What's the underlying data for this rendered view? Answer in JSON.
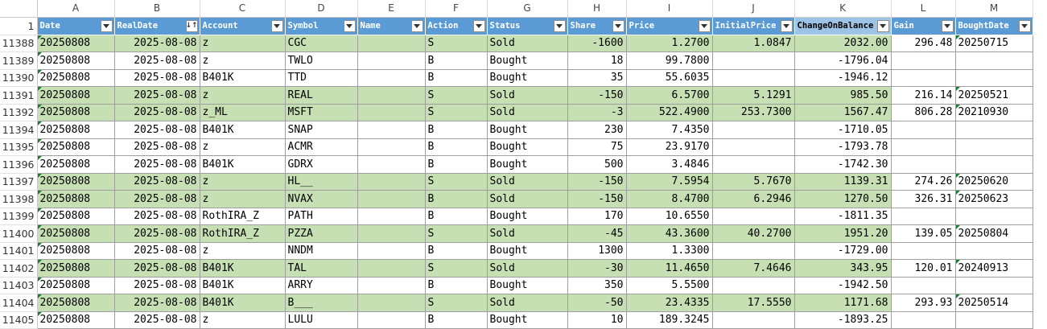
{
  "colLetters": [
    "A",
    "B",
    "C",
    "D",
    "E",
    "F",
    "G",
    "H",
    "I",
    "J",
    "K",
    "L",
    "M"
  ],
  "headerRowNumber": "1",
  "fields": [
    "Date",
    "RealDate",
    "Account",
    "Symbol",
    "Name",
    "Action",
    "Status",
    "Share",
    "Price",
    "InitialPrice",
    "ChangeOnBalance",
    "Gain",
    "BoughtDate"
  ],
  "activeFilterColumn": "RealDate",
  "selectedHeader": "ChangeOnBalance",
  "rows": [
    {
      "r": "11388",
      "Date": "20250808",
      "RealDate": "2025-08-08",
      "Account": "z",
      "Symbol": "CGC",
      "Name": "",
      "Action": "S",
      "Status": "Sold",
      "Share": "-1600",
      "Price": "1.2700",
      "InitialPrice": "1.0847",
      "ChangeOnBalance": "2032.00",
      "Gain": "296.48",
      "BoughtDate": "20250715"
    },
    {
      "r": "11389",
      "Date": "20250808",
      "RealDate": "2025-08-08",
      "Account": "z",
      "Symbol": "TWLO",
      "Name": "",
      "Action": "B",
      "Status": "Bought",
      "Share": "18",
      "Price": "99.7800",
      "InitialPrice": "",
      "ChangeOnBalance": "-1796.04",
      "Gain": "",
      "BoughtDate": ""
    },
    {
      "r": "11390",
      "Date": "20250808",
      "RealDate": "2025-08-08",
      "Account": "B401K",
      "Symbol": "TTD",
      "Name": "",
      "Action": "B",
      "Status": "Bought",
      "Share": "35",
      "Price": "55.6035",
      "InitialPrice": "",
      "ChangeOnBalance": "-1946.12",
      "Gain": "",
      "BoughtDate": ""
    },
    {
      "r": "11391",
      "Date": "20250808",
      "RealDate": "2025-08-08",
      "Account": "z",
      "Symbol": "REAL",
      "Name": "",
      "Action": "S",
      "Status": "Sold",
      "Share": "-150",
      "Price": "6.5700",
      "InitialPrice": "5.1291",
      "ChangeOnBalance": "985.50",
      "Gain": "216.14",
      "BoughtDate": "20250521"
    },
    {
      "r": "11392",
      "Date": "20250808",
      "RealDate": "2025-08-08",
      "Account": "z_ML",
      "Symbol": "MSFT",
      "Name": "",
      "Action": "S",
      "Status": "Sold",
      "Share": "-3",
      "Price": "522.4900",
      "InitialPrice": "253.7300",
      "ChangeOnBalance": "1567.47",
      "Gain": "806.28",
      "BoughtDate": "20210930"
    },
    {
      "r": "11394",
      "Date": "20250808",
      "RealDate": "2025-08-08",
      "Account": "B401K",
      "Symbol": "SNAP",
      "Name": "",
      "Action": "B",
      "Status": "Bought",
      "Share": "230",
      "Price": "7.4350",
      "InitialPrice": "",
      "ChangeOnBalance": "-1710.05",
      "Gain": "",
      "BoughtDate": ""
    },
    {
      "r": "11395",
      "Date": "20250808",
      "RealDate": "2025-08-08",
      "Account": "z",
      "Symbol": "ACMR",
      "Name": "",
      "Action": "B",
      "Status": "Bought",
      "Share": "75",
      "Price": "23.9170",
      "InitialPrice": "",
      "ChangeOnBalance": "-1793.78",
      "Gain": "",
      "BoughtDate": ""
    },
    {
      "r": "11396",
      "Date": "20250808",
      "RealDate": "2025-08-08",
      "Account": "B401K",
      "Symbol": "GDRX",
      "Name": "",
      "Action": "B",
      "Status": "Bought",
      "Share": "500",
      "Price": "3.4846",
      "InitialPrice": "",
      "ChangeOnBalance": "-1742.30",
      "Gain": "",
      "BoughtDate": ""
    },
    {
      "r": "11397",
      "Date": "20250808",
      "RealDate": "2025-08-08",
      "Account": "z",
      "Symbol": "HL__",
      "Name": "",
      "Action": "S",
      "Status": "Sold",
      "Share": "-150",
      "Price": "7.5954",
      "InitialPrice": "5.7670",
      "ChangeOnBalance": "1139.31",
      "Gain": "274.26",
      "BoughtDate": "20250620"
    },
    {
      "r": "11398",
      "Date": "20250808",
      "RealDate": "2025-08-08",
      "Account": "z",
      "Symbol": "NVAX",
      "Name": "",
      "Action": "B",
      "Status": "Sold",
      "Share": "-150",
      "Price": "8.4700",
      "InitialPrice": "6.2946",
      "ChangeOnBalance": "1270.50",
      "Gain": "326.31",
      "BoughtDate": "20250623"
    },
    {
      "r": "11399",
      "Date": "20250808",
      "RealDate": "2025-08-08",
      "Account": "RothIRA_Z",
      "Symbol": "PATH",
      "Name": "",
      "Action": "B",
      "Status": "Bought",
      "Share": "170",
      "Price": "10.6550",
      "InitialPrice": "",
      "ChangeOnBalance": "-1811.35",
      "Gain": "",
      "BoughtDate": ""
    },
    {
      "r": "11400",
      "Date": "20250808",
      "RealDate": "2025-08-08",
      "Account": "RothIRA_Z",
      "Symbol": "PZZA",
      "Name": "",
      "Action": "S",
      "Status": "Sold",
      "Share": "-45",
      "Price": "43.3600",
      "InitialPrice": "40.2700",
      "ChangeOnBalance": "1951.20",
      "Gain": "139.05",
      "BoughtDate": "20250804"
    },
    {
      "r": "11401",
      "Date": "20250808",
      "RealDate": "2025-08-08",
      "Account": "z",
      "Symbol": "NNDM",
      "Name": "",
      "Action": "B",
      "Status": "Bought",
      "Share": "1300",
      "Price": "1.3300",
      "InitialPrice": "",
      "ChangeOnBalance": "-1729.00",
      "Gain": "",
      "BoughtDate": ""
    },
    {
      "r": "11402",
      "Date": "20250808",
      "RealDate": "2025-08-08",
      "Account": "B401K",
      "Symbol": "TAL",
      "Name": "",
      "Action": "S",
      "Status": "Sold",
      "Share": "-30",
      "Price": "11.4650",
      "InitialPrice": "7.4646",
      "ChangeOnBalance": "343.95",
      "Gain": "120.01",
      "BoughtDate": "20240913"
    },
    {
      "r": "11403",
      "Date": "20250808",
      "RealDate": "2025-08-08",
      "Account": "B401K",
      "Symbol": "ARRY",
      "Name": "",
      "Action": "B",
      "Status": "Bought",
      "Share": "350",
      "Price": "5.5500",
      "InitialPrice": "",
      "ChangeOnBalance": "-1942.50",
      "Gain": "",
      "BoughtDate": ""
    },
    {
      "r": "11404",
      "Date": "20250808",
      "RealDate": "2025-08-08",
      "Account": "B401K",
      "Symbol": "B___",
      "Name": "",
      "Action": "S",
      "Status": "Sold",
      "Share": "-50",
      "Price": "23.4335",
      "InitialPrice": "17.5550",
      "ChangeOnBalance": "1171.68",
      "Gain": "293.93",
      "BoughtDate": "20250514"
    },
    {
      "r": "11405",
      "Date": "20250808",
      "RealDate": "2025-08-08",
      "Account": "z",
      "Symbol": "LULU",
      "Name": "",
      "Action": "B",
      "Status": "Bought",
      "Share": "10",
      "Price": "189.3245",
      "InitialPrice": "",
      "ChangeOnBalance": "-1893.25",
      "Gain": "",
      "BoughtDate": ""
    }
  ],
  "colors": {
    "headerBlue": "#5b9bd5",
    "selectedHeader": "#9dc3e6",
    "soldRowGreen": "#c6e0b4",
    "gridLine": "#9e9e9e",
    "errorMarker": "#1e7b34"
  },
  "icons": {
    "filterButton": "filter-dropdown-icon",
    "activeFilter": "sort-filter-icon",
    "cellMarker": "error-indicator-icon"
  }
}
